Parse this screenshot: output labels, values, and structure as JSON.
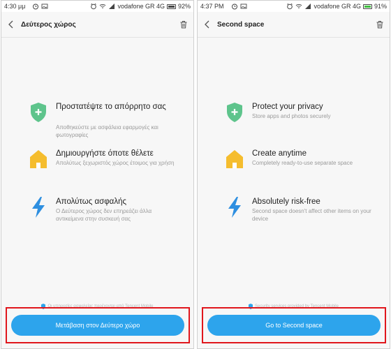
{
  "screens": [
    {
      "status": {
        "time": "4:30 μμ",
        "carrier": "vodafone GR 4G",
        "battery": "92%",
        "battery_level": 0.92,
        "charging": false
      },
      "title": "Δεύτερος χώρος",
      "features": [
        {
          "icon": "shield-plus-icon",
          "title": "Προστατέψτε το απόρρητο σας",
          "desc": "Αποθηκεύστε με ασφάλεια εφαρμογές και φωτογραφίες"
        },
        {
          "icon": "house-icon",
          "title": "Δημιουργήστε όποτε θέλετε",
          "desc": "Απολύτως ξεχωριστός χώρος έτοιμος για χρήση"
        },
        {
          "icon": "lightning-icon",
          "title": "Απολύτως ασφαλής",
          "desc": "Ο Δεύτερος χώρος δεν επηρεάζει άλλα αντικείμενα στην συσκευή σας"
        }
      ],
      "provider": "Οι υπηρεσίες ασφαλείας παρέχονται από Tencent Mobile",
      "button": "Μετάβαση στον Δεύτερο χώρο"
    },
    {
      "status": {
        "time": "4:37 PM",
        "carrier": "vodafone GR 4G",
        "battery": "91%",
        "battery_level": 0.91,
        "charging": true
      },
      "title": "Second space",
      "features": [
        {
          "icon": "shield-plus-icon",
          "title": "Protect your privacy",
          "desc": "Store apps and photos securely"
        },
        {
          "icon": "house-icon",
          "title": "Create anytime",
          "desc": "Completely ready-to-use separate space"
        },
        {
          "icon": "lightning-icon",
          "title": "Absolutely risk-free",
          "desc": "Second space doesn't affect other items on your device"
        }
      ],
      "provider": "Security services provided by Tencent Mobile",
      "button": "Go to Second space"
    }
  ],
  "colors": {
    "accent": "#2da4ec",
    "shield": "#5ec48c",
    "house": "#f5bd2e",
    "lightning": "#2e8fe0",
    "highlight_frame": "#e0161c"
  }
}
